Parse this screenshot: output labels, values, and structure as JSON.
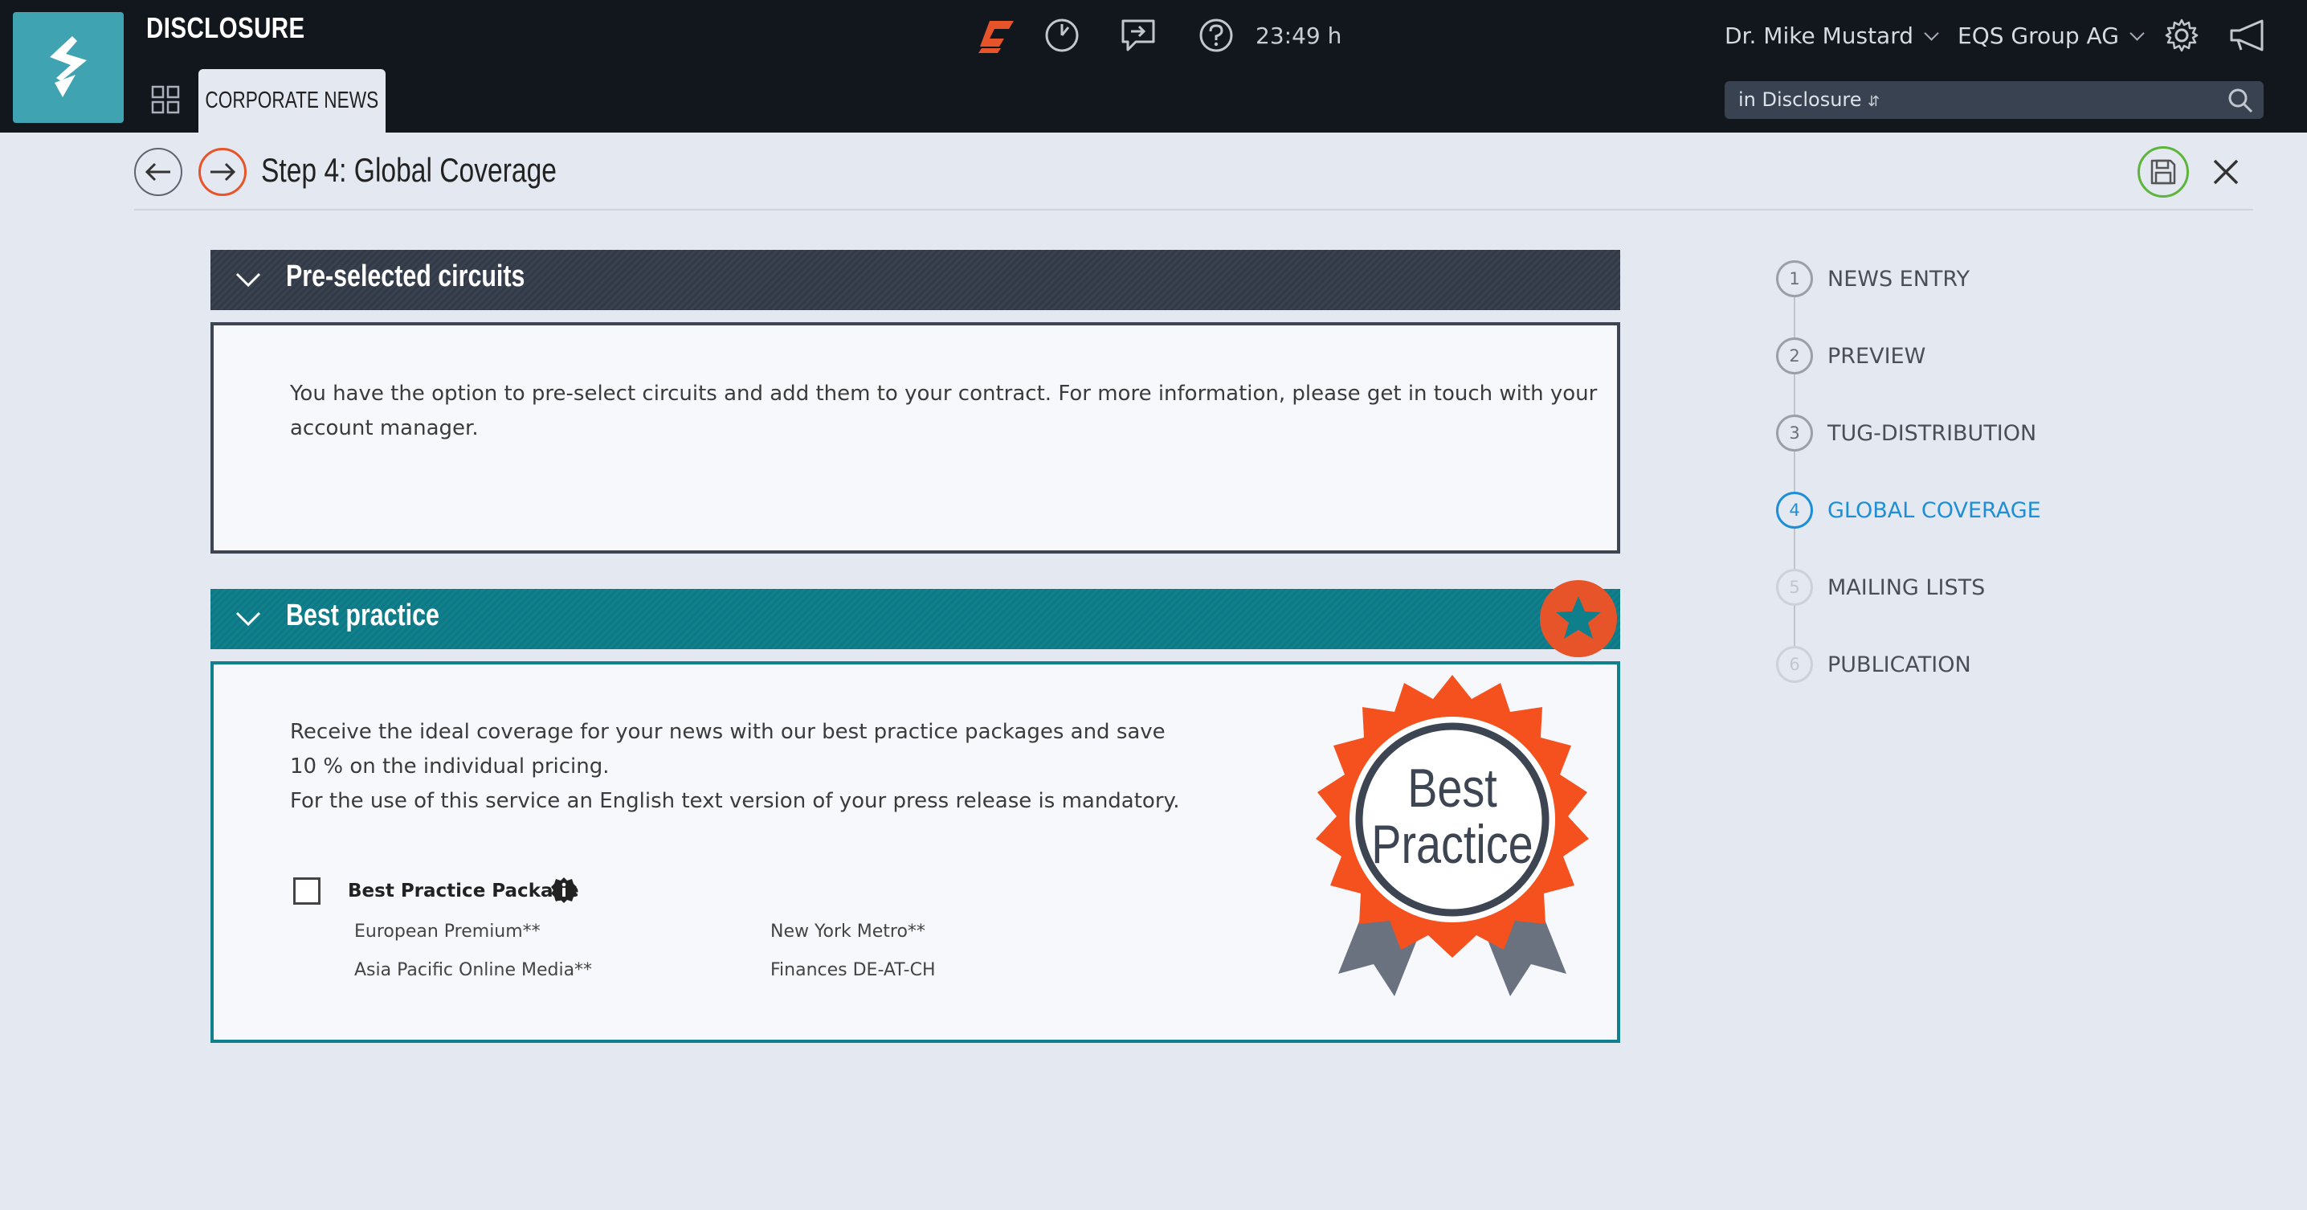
{
  "app": {
    "title": "DISCLOSURE",
    "tab": "CORPORATE NEWS"
  },
  "topbar": {
    "time": "23:49 h",
    "user": "Dr. Mike Mustard",
    "company": "EQS Group AG",
    "search_scope": "in Disclosure"
  },
  "step": {
    "title": "Step 4: Global Coverage"
  },
  "preselected": {
    "title": "Pre-selected circuits",
    "text_line1": "You have the option to pre-select circuits and add them to your contract. For more information, please get in touch with your",
    "text_line2": "account manager."
  },
  "best_practice": {
    "title": "Best practice",
    "line1": "Receive the ideal coverage for your news with our best practice packages and save",
    "line2": "10 % on the individual pricing.",
    "line3": "For the use of this service an English text version of your press release is mandatory.",
    "package_label": "Best Practice Package",
    "circuits": [
      "European Premium**",
      "New York Metro**",
      "Asia Pacific Online Media**",
      "Finances DE-AT-CH"
    ],
    "rosette_line1": "Best",
    "rosette_line2": "Practice"
  },
  "steps": [
    {
      "num": "1",
      "label": "NEWS ENTRY"
    },
    {
      "num": "2",
      "label": "PREVIEW"
    },
    {
      "num": "3",
      "label": "TUG-DISTRIBUTION"
    },
    {
      "num": "4",
      "label": "GLOBAL COVERAGE"
    },
    {
      "num": "5",
      "label": "MAILING LISTS"
    },
    {
      "num": "6",
      "label": "PUBLICATION"
    }
  ],
  "colors": {
    "accent": "#e8542a",
    "teal": "#11808d",
    "active_step": "#1e8fd6",
    "topbar": "#12161d"
  }
}
